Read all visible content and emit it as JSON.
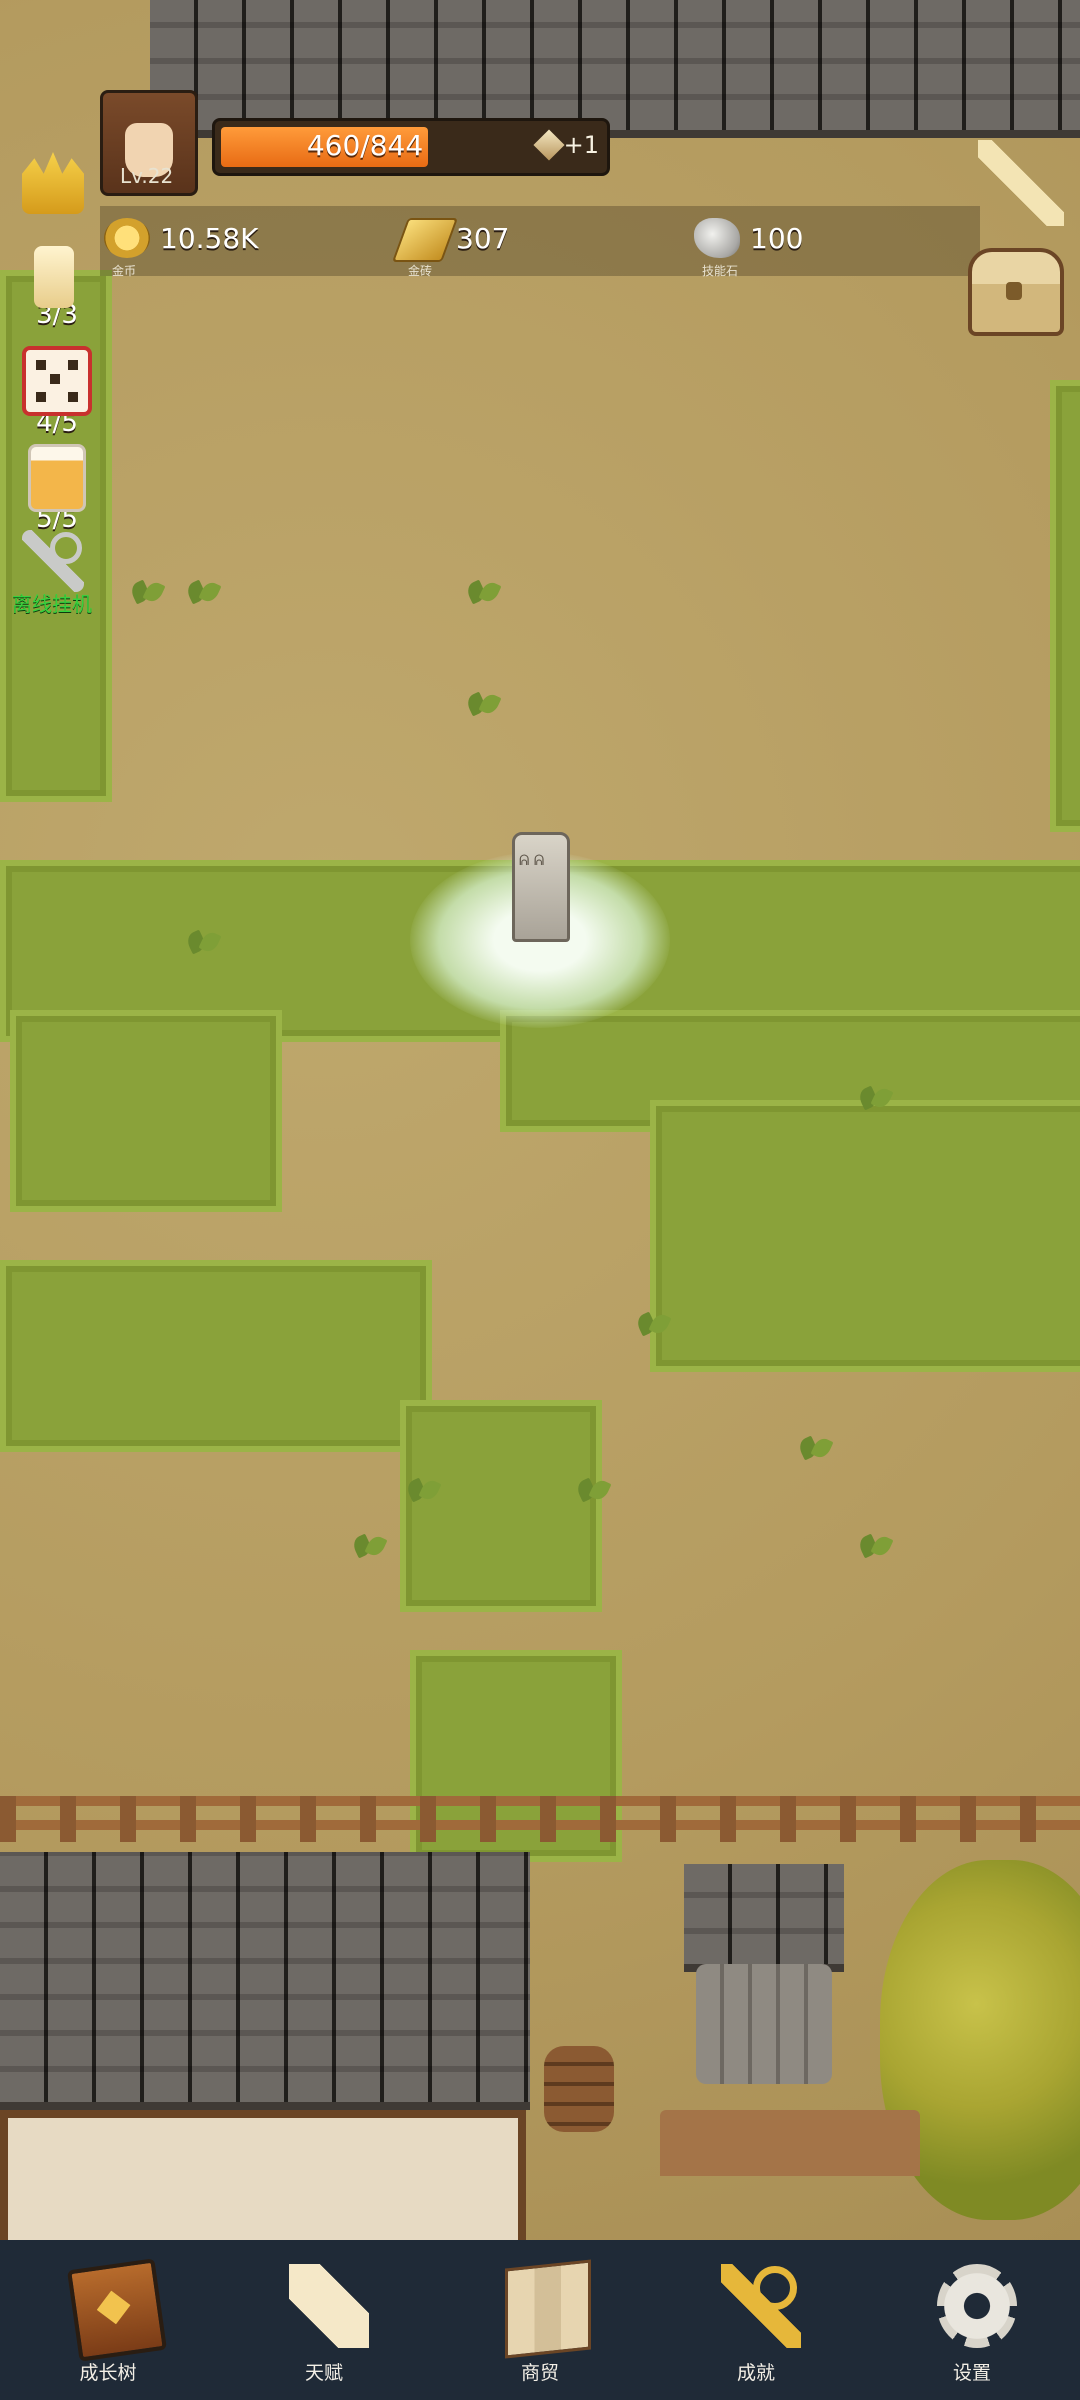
{
  "player": {
    "level": "Lv.22"
  },
  "xp": {
    "text": "460/844",
    "plus": "+1",
    "progress": 0.545
  },
  "resources": [
    {
      "name": "coins",
      "value": "10.58K",
      "label": "金币",
      "icon": "coin-icon"
    },
    {
      "name": "gold-bars",
      "value": "307",
      "label": "金砖",
      "icon": "gold-bar-icon"
    },
    {
      "name": "skill-stone",
      "value": "100",
      "label": "技能石",
      "icon": "skill-stone-icon"
    }
  ],
  "side_items": [
    {
      "icon": "crown-icon",
      "count": ""
    },
    {
      "icon": "candle-icon",
      "count": "3/3"
    },
    {
      "icon": "dice-icon",
      "count": "4/5"
    },
    {
      "icon": "beer-icon",
      "count": "5/5"
    },
    {
      "icon": "key-icon",
      "label": "离线挂机"
    }
  ],
  "nav": [
    {
      "label": "成长树",
      "icon": "book-icon"
    },
    {
      "label": "天赋",
      "icon": "scroll-icon"
    },
    {
      "label": "商贸",
      "icon": "map-icon"
    },
    {
      "label": "成就",
      "icon": "key-icon"
    },
    {
      "label": "设置",
      "icon": "gear-icon"
    }
  ]
}
